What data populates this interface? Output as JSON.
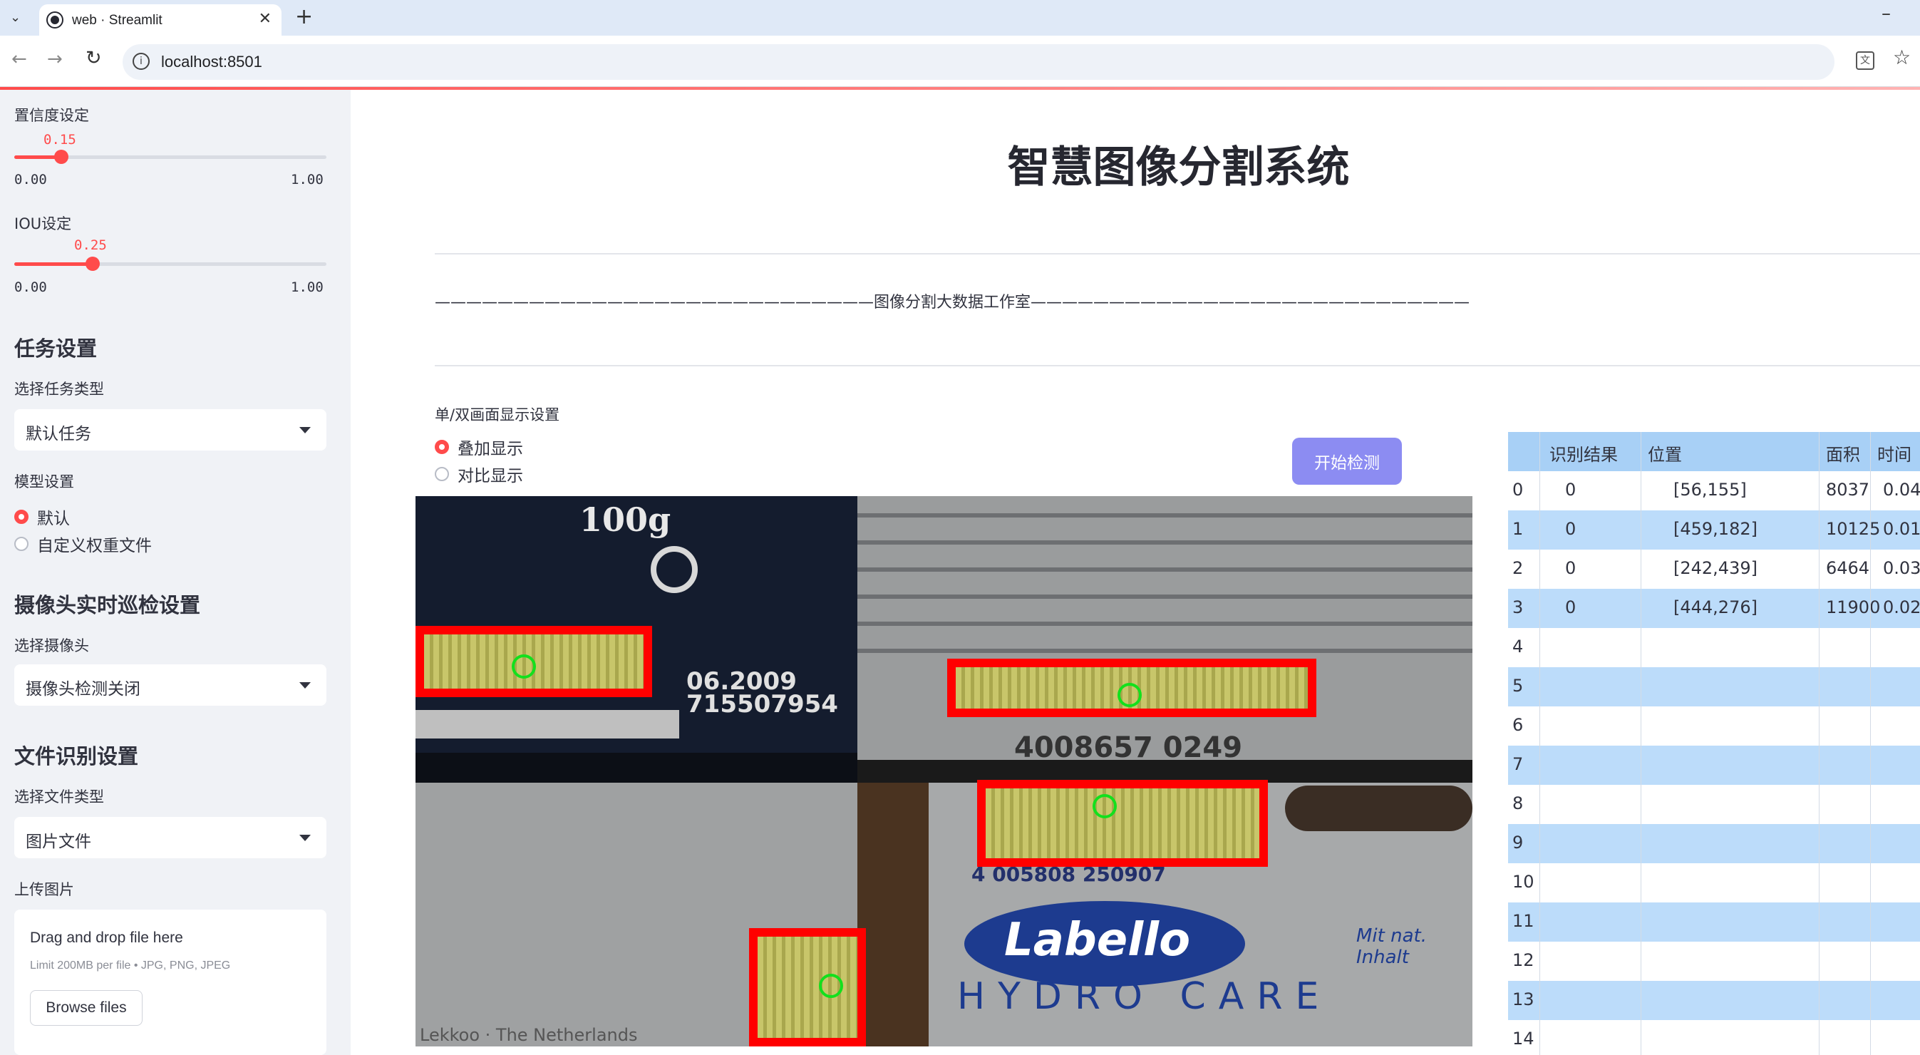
{
  "browser": {
    "tab_title": "web · Streamlit",
    "url": "localhost:8501"
  },
  "sidebar": {
    "confidence": {
      "label": "置信度设定",
      "value": "0.15",
      "min": "0.00",
      "max": "1.00",
      "fraction": 0.15
    },
    "iou": {
      "label": "IOU设定",
      "value": "0.25",
      "min": "0.00",
      "max": "1.00",
      "fraction": 0.25
    },
    "task_section": "任务设置",
    "task_type_label": "选择任务类型",
    "task_type_value": "默认任务",
    "model_label": "模型设置",
    "model_options": [
      "默认",
      "自定义权重文件"
    ],
    "model_selected": 0,
    "camera_section": "摄像头实时巡检设置",
    "camera_label": "选择摄像头",
    "camera_value": "摄像头检测关闭",
    "file_section": "文件识别设置",
    "file_type_label": "选择文件类型",
    "file_type_value": "图片文件",
    "upload_label": "上传图片",
    "upload_drop": "Drag and drop file here",
    "upload_limit": "Limit 200MB per file • JPG, PNG, JPEG",
    "upload_button": "Browse files"
  },
  "main": {
    "title": "智慧图像分割系统",
    "studio_line": "————————————————————————————图像分割大数据工作室————————————————————————————",
    "display_label": "单/双画面显示设置",
    "display_options": [
      "叠加显示",
      "对比显示"
    ],
    "display_selected": 0,
    "detect_button": "开始检测"
  },
  "results_table": {
    "columns": [
      "",
      "识别结果",
      "位置",
      "面积",
      "时间"
    ],
    "rows": [
      {
        "idx": "0",
        "result": "0",
        "pos": "[56,155]",
        "area": "8037",
        "time": "0.04"
      },
      {
        "idx": "1",
        "result": "0",
        "pos": "[459,182]",
        "area": "10125",
        "time": "0.01"
      },
      {
        "idx": "2",
        "result": "0",
        "pos": "[242,439]",
        "area": "6464",
        "time": "0.03"
      },
      {
        "idx": "3",
        "result": "0",
        "pos": "[444,276]",
        "area": "11900",
        "time": "0.02"
      },
      {
        "idx": "4",
        "result": "",
        "pos": "",
        "area": "",
        "time": ""
      },
      {
        "idx": "5",
        "result": "",
        "pos": "",
        "area": "",
        "time": ""
      },
      {
        "idx": "6",
        "result": "",
        "pos": "",
        "area": "",
        "time": ""
      },
      {
        "idx": "7",
        "result": "",
        "pos": "",
        "area": "",
        "time": ""
      },
      {
        "idx": "8",
        "result": "",
        "pos": "",
        "area": "",
        "time": ""
      },
      {
        "idx": "9",
        "result": "",
        "pos": "",
        "area": "",
        "time": ""
      },
      {
        "idx": "10",
        "result": "",
        "pos": "",
        "area": "",
        "time": ""
      },
      {
        "idx": "11",
        "result": "",
        "pos": "",
        "area": "",
        "time": ""
      },
      {
        "idx": "12",
        "result": "",
        "pos": "",
        "area": "",
        "time": ""
      },
      {
        "idx": "13",
        "result": "",
        "pos": "",
        "area": "",
        "time": ""
      },
      {
        "idx": "14",
        "result": "",
        "pos": "",
        "area": "",
        "time": ""
      }
    ]
  },
  "image_text": {
    "q1_weight": "100g",
    "q1_date": "06.2009",
    "q1_code": "715507954",
    "q2_code": "4008657 0249",
    "q3_footer": "Lekkoo · The Netherlands",
    "q4_code": "4 005808 250907",
    "q4_brand": "Labello",
    "q4_line": "HYDRO CARE",
    "q4_tag": "Mit nat. Inhalt"
  },
  "colors": {
    "accent": "#ff4b4b",
    "sidebar_bg": "#f0f2f6",
    "button": "#8c8cf2",
    "table_even": "#bcdcfa",
    "box": "#ff0000",
    "ring": "#13e01d"
  }
}
